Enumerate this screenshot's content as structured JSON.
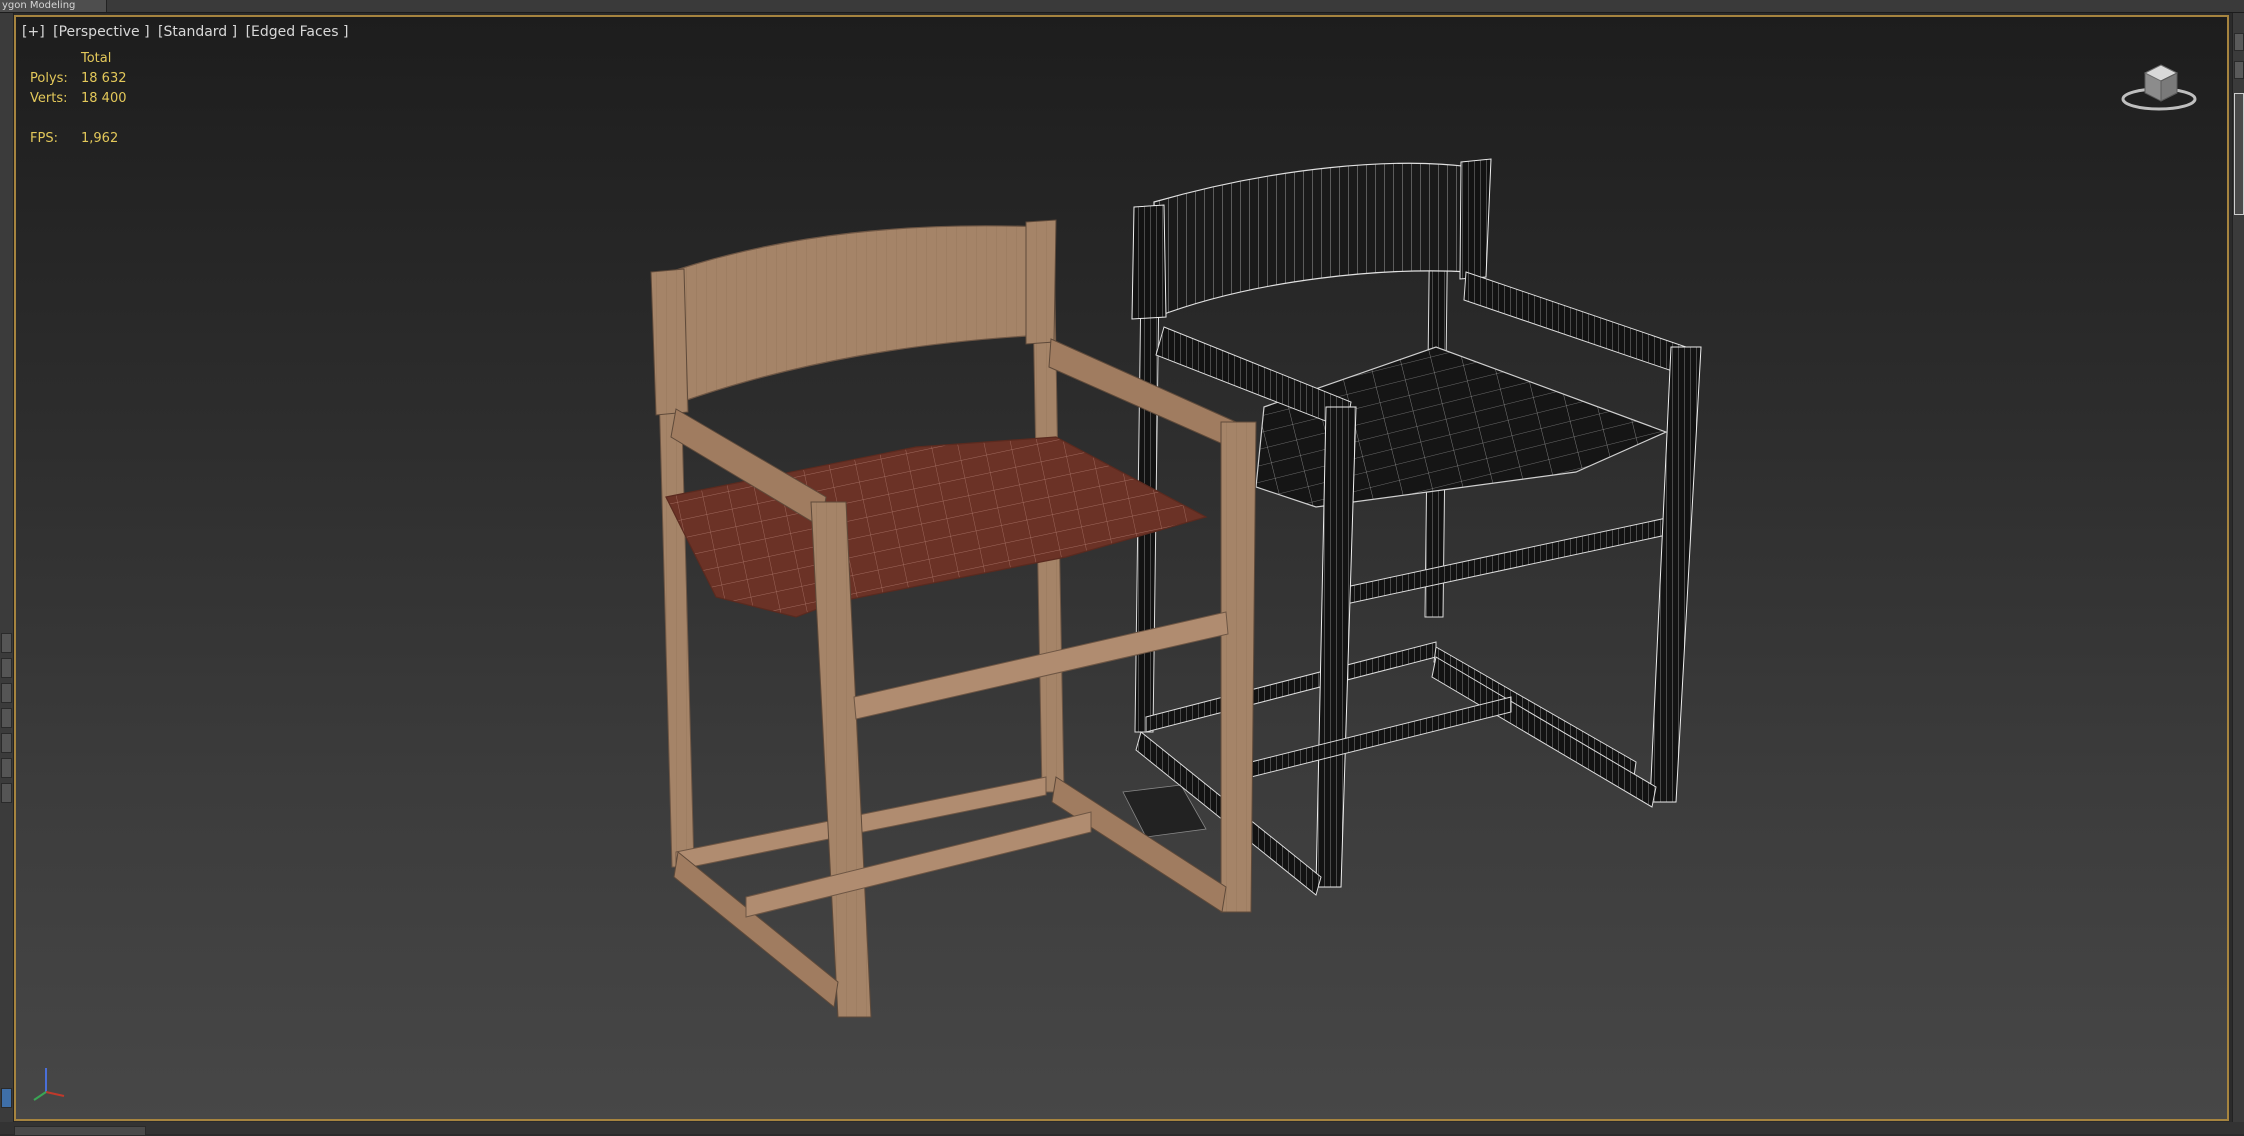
{
  "ribbon": {
    "tab_label": "ygon Modeling"
  },
  "viewport": {
    "label_parts": [
      "[+]",
      "[Perspective ]",
      "[Standard ]",
      "[Edged Faces ]"
    ]
  },
  "stats": {
    "header": "Total",
    "polys_label": "Polys:",
    "polys_value": "18 632",
    "verts_label": "Verts:",
    "verts_value": "18 400",
    "fps_label": "FPS:",
    "fps_value": "1,962"
  },
  "viewcube": {
    "icon": "viewcube-icon"
  },
  "axis": {
    "icon": "axis-tripod-icon"
  },
  "colors": {
    "stats_text": "#e3c85a",
    "viewport_border": "#a6843f",
    "wood": "#a58468",
    "seat_leather": "#6b3226",
    "wireframe_line": "#d0d0d0"
  }
}
